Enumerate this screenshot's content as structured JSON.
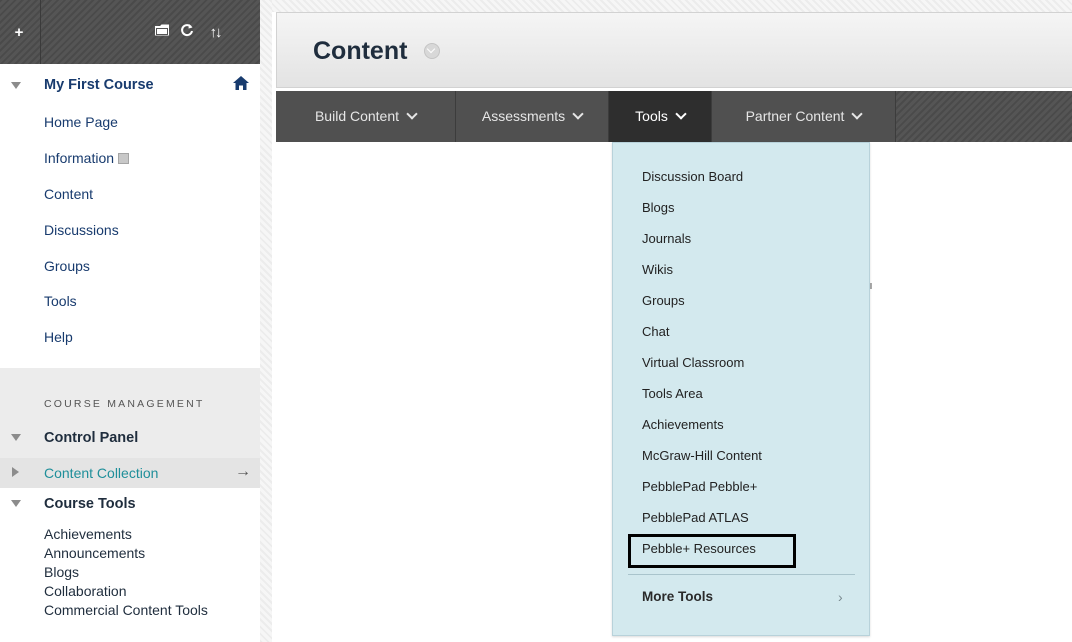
{
  "toolbar": {
    "add": "+",
    "folder_icon": "folder-icon",
    "refresh_icon": "refresh-icon",
    "sort": "↑↓"
  },
  "course": {
    "title": "My First Course",
    "items": [
      {
        "label": "Home Page"
      },
      {
        "label": "Information"
      },
      {
        "label": "Content"
      },
      {
        "label": "Discussions"
      },
      {
        "label": "Groups"
      },
      {
        "label": "Tools"
      },
      {
        "label": "Help"
      }
    ]
  },
  "management": {
    "heading": "COURSE MANAGEMENT",
    "control_panel": "Control Panel",
    "content_collection": "Content Collection",
    "content_collection_arrow": "→",
    "course_tools": "Course Tools",
    "course_tools_items": [
      "Achievements",
      "Announcements",
      "Blogs",
      "Collaboration",
      "Commercial Content Tools"
    ]
  },
  "page": {
    "title": "Content"
  },
  "nav": {
    "tabs": [
      {
        "label": "Build Content",
        "active": false
      },
      {
        "label": "Assessments",
        "active": false
      },
      {
        "label": "Tools",
        "active": true
      },
      {
        "label": "Partner Content",
        "active": false
      }
    ]
  },
  "dropdown": {
    "items": [
      "Discussion Board",
      "Blogs",
      "Journals",
      "Wikis",
      "Groups",
      "Chat",
      "Virtual Classroom",
      "Tools Area",
      "Achievements",
      "McGraw-Hill Content",
      "PebblePad Pebble+",
      "PebblePad ATLAS",
      "Pebble+ Resources"
    ],
    "highlighted": "Pebble+ Resources",
    "more_tools": "More Tools",
    "more_chevron": "›"
  },
  "colors": {
    "link": "#183b6e",
    "accent_link": "#1f8f9a",
    "dropdown_bg": "#d3e9ee",
    "nav_bg": "#505050",
    "nav_active": "#2e2e2e"
  }
}
